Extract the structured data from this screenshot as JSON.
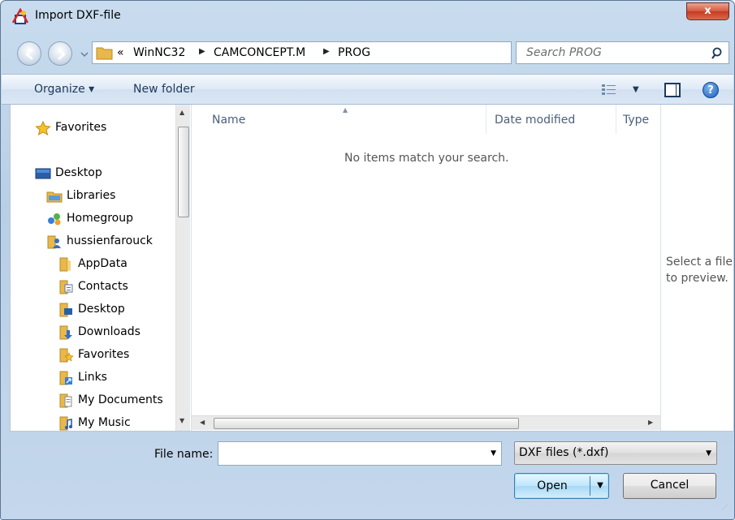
{
  "window": {
    "title": "Import DXF-file",
    "close_label": "x"
  },
  "address": {
    "overflow": "«",
    "crumbs": [
      "WinNC32",
      "CAMCONCEPT.M",
      "PROG"
    ],
    "separator": "▶"
  },
  "search": {
    "placeholder": "Search PROG"
  },
  "toolbar": {
    "organize": "Organize ▾",
    "new_folder": "New folder",
    "help": "?"
  },
  "nav": {
    "favorites": "Favorites",
    "desktop": "Desktop",
    "libraries": "Libraries",
    "homegroup": "Homegroup",
    "user": "hussienfarouck",
    "children": [
      "AppData",
      "Contacts",
      "Desktop",
      "Downloads",
      "Favorites",
      "Links",
      "My Documents",
      "My Music"
    ]
  },
  "filelist": {
    "columns": [
      "Name",
      "Date modified",
      "Type"
    ],
    "empty_message": "No items match your search."
  },
  "preview": {
    "text": "Select a file to preview."
  },
  "bottom": {
    "file_name_label": "File name:",
    "file_name_value": "",
    "filter": "DXF files (*.dxf)",
    "open": "Open",
    "cancel": "Cancel"
  },
  "colors": {
    "accent": "#3c7fb1",
    "folder": "#e8b84a"
  }
}
